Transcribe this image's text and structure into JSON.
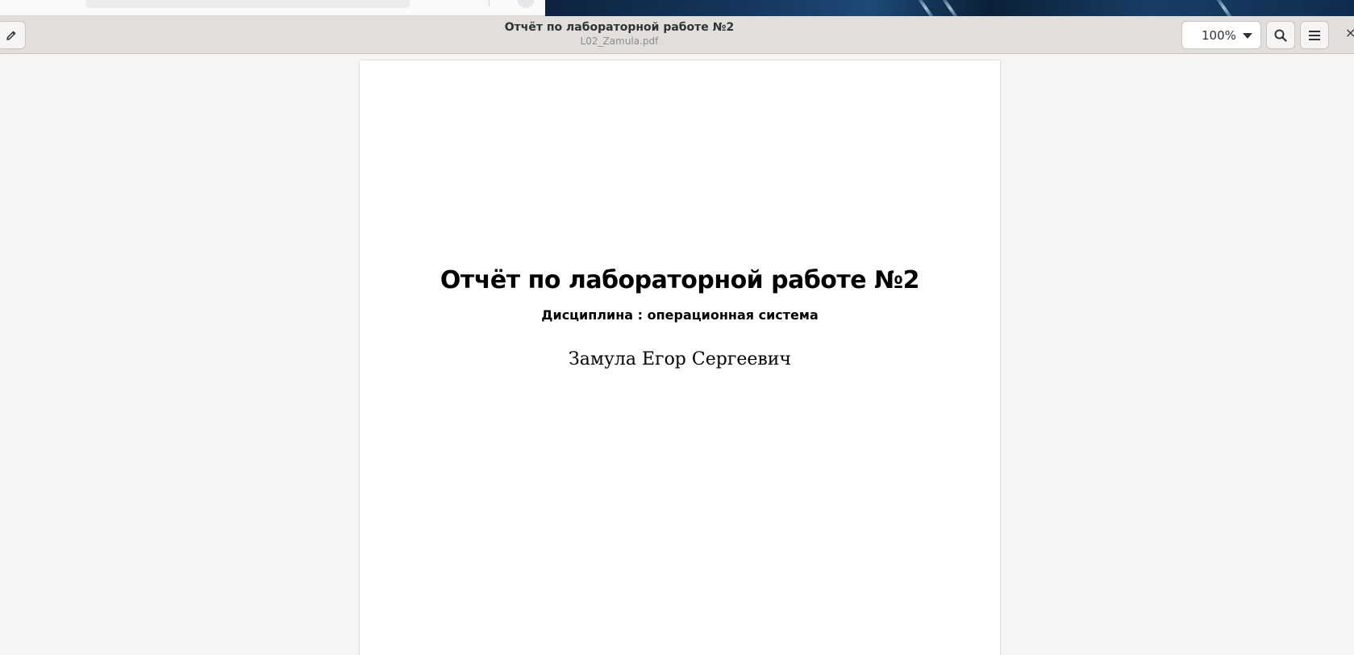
{
  "header": {
    "title": "Отчёт по лабораторной работе №2",
    "subtitle": "L02_Zamula.pdf",
    "zoom": "100%",
    "close_glyph": "×"
  },
  "icons": {
    "edit": "pencil-icon",
    "search": "search-icon",
    "menu": "hamburger-menu-icon",
    "zoom_dropdown": "chevron-down-icon",
    "close": "close-icon"
  },
  "document": {
    "title": "Отчёт по лабораторной работе №2",
    "subtitle": "Дисциплина : операционная система",
    "author": "Замула Егор Сергеевич"
  }
}
